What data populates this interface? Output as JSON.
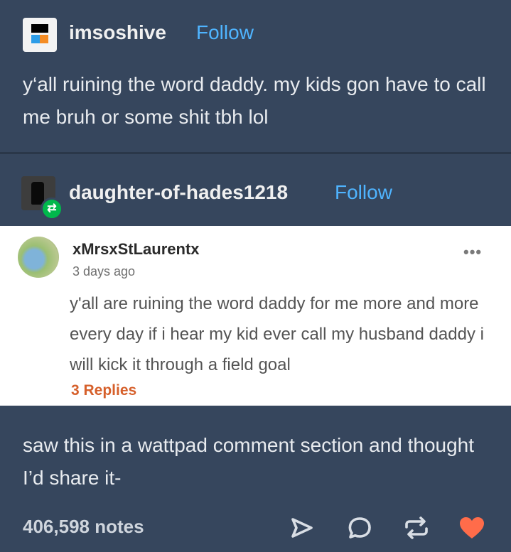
{
  "post": {
    "author": "imsoshive",
    "follow_label": "Follow",
    "text": "y‘all ruining the word daddy. my kids gon have to call me bruh or some shit tbh lol"
  },
  "reblog": {
    "author": "daughter-of-hades1218",
    "follow_label": "Follow",
    "embedded_comment": {
      "username": "xMrsxStLaurentx",
      "time": "3 days ago",
      "text": "y'all are ruining the word daddy for me more and more every day if i hear my kid ever call my husband daddy i will kick it through a field goal",
      "replies": "3 Replies",
      "menu": "•••"
    },
    "text": "saw this in a wattpad comment section and thought I’d share it-"
  },
  "footer": {
    "notes": "406,598 notes",
    "actions": [
      "share-icon",
      "reply-icon",
      "reblog-icon",
      "like-icon"
    ]
  },
  "colors": {
    "background": "#36465d",
    "follow": "#4fb4ff",
    "replies": "#d6602b",
    "like": "#ff6c4a",
    "reblog_badge": "#00b84c"
  }
}
